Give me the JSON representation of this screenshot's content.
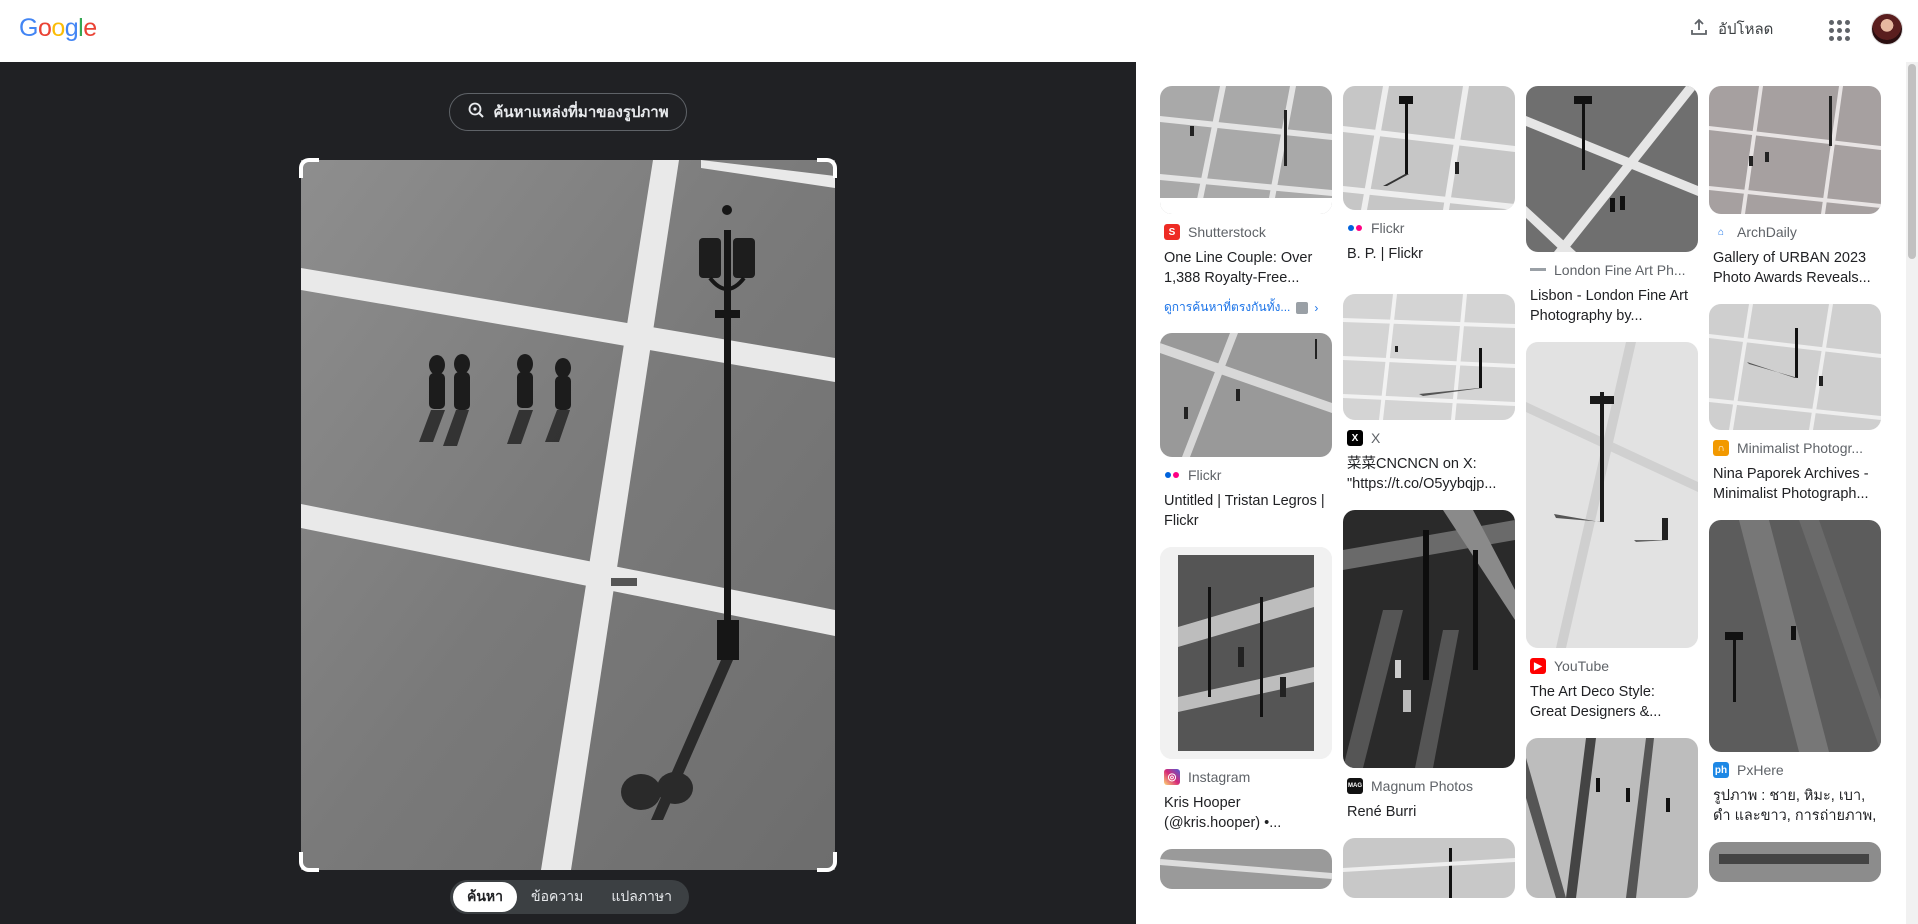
{
  "header": {
    "logo_letters": [
      {
        "ch": "G",
        "color": "#4285F4"
      },
      {
        "ch": "o",
        "color": "#EA4335"
      },
      {
        "ch": "o",
        "color": "#FBBC05"
      },
      {
        "ch": "g",
        "color": "#4285F4"
      },
      {
        "ch": "l",
        "color": "#34A853"
      },
      {
        "ch": "e",
        "color": "#EA4335"
      }
    ],
    "upload_label": "อัปโหลด",
    "upload_icon": "upload-icon",
    "apps_icon": "apps-grid-icon"
  },
  "lens": {
    "find_source_label": "ค้นหาแหล่งที่มาของรูปภาพ",
    "find_source_icon": "image-search-icon",
    "modes": [
      "ค้นหา",
      "ข้อความ",
      "แปลภาษา"
    ],
    "active_mode": "ค้นหา"
  },
  "results": {
    "col1": [
      {
        "source": "Shutterstock",
        "favicon": "shutterstock-icon",
        "fav_color": "#ee2b24",
        "title": "One Line Couple: Over 1,388 Royalty-Free...",
        "related": "ดูการค้นหาที่ตรงกันทั้ง..."
      },
      {
        "source": "Flickr",
        "favicon": "flickr-icon",
        "fav_color": "#ffffff",
        "title": "Untitled | Tristan Legros | Flickr"
      },
      {
        "source": "Instagram",
        "favicon": "instagram-icon",
        "fav_color": "#d62976",
        "title": "Kris Hooper (@kris.hooper) •..."
      }
    ],
    "col2": [
      {
        "source": "Flickr",
        "favicon": "flickr-icon",
        "fav_color": "#ffffff",
        "title": "B. P. | Flickr"
      },
      {
        "source": "X",
        "favicon": "x-icon",
        "fav_color": "#000000",
        "title": "菜菜CNCNCN on X: \"https://t.co/O5yybqjp..."
      },
      {
        "source": "Magnum Photos",
        "favicon": "magnum-icon",
        "fav_color": "#111111",
        "title": "René Burri"
      }
    ],
    "col3": [
      {
        "source": "London Fine Art Ph...",
        "favicon": "london-fine-art-icon",
        "fav_color": "#9aa0a6",
        "title": "Lisbon - London Fine Art Photography by..."
      },
      {
        "source": "YouTube",
        "favicon": "youtube-icon",
        "fav_color": "#ff0000",
        "title": "The Art Deco Style: Great Designers &..."
      }
    ],
    "col4": [
      {
        "source": "ArchDaily",
        "favicon": "archdaily-icon",
        "fav_color": "#ffffff",
        "title": "Gallery of URBAN 2023 Photo Awards Reveals..."
      },
      {
        "source": "Minimalist Photogr...",
        "favicon": "minimalist-icon",
        "fav_color": "#f29900",
        "title": "Nina Paporek Archives - Minimalist Photograph..."
      },
      {
        "source": "PxHere",
        "favicon": "pxhere-icon",
        "fav_color": "#1e88e5",
        "title": "รูปภาพ : ชาย, หิมะ, เบา, ดำ และขาว, การถ่ายภาพ, ดู,..."
      }
    ]
  }
}
